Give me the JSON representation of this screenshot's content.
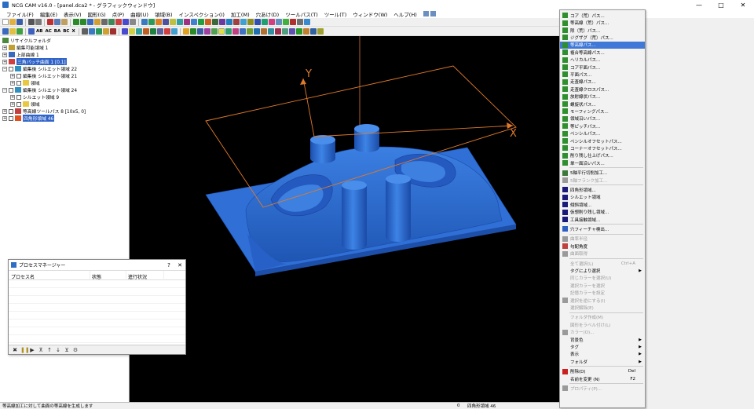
{
  "window": {
    "title": "NCG CAM v16.0 - [panel.dca2 * - グラフィックウィンドウ]"
  },
  "menubar": [
    "ファイル(F)",
    "編集(E)",
    "表示(V)",
    "図形(G)",
    "点(P)",
    "曲線(U)",
    "領域(B)",
    "インスペクション(I)",
    "加工(M)",
    "穴あけ(D)",
    "ツールパス(T)",
    "ツール(T)",
    "ウィンドウ(W)",
    "ヘルプ(H)"
  ],
  "toolbar": {
    "labels": [
      "AB",
      "AC",
      "BA",
      "BC",
      "X"
    ]
  },
  "tree": {
    "items": [
      {
        "label": "リサイクルフォルダ",
        "expander": ""
      },
      {
        "label": "編集可能領域 1",
        "expander": "+"
      },
      {
        "label": "上部曲線 1",
        "expander": "+"
      },
      {
        "label": "三角パッチ曲面 1 [0.1]",
        "expander": "+"
      },
      {
        "label": "編集後 シルエット領域 22",
        "expander": "−"
      },
      {
        "label": "編集後 シルエット領域 21",
        "expander": "+"
      },
      {
        "label": "領域",
        "expander": "+"
      },
      {
        "label": "編集後 シルエット領域 24",
        "expander": "−"
      },
      {
        "label": "シルエット領域 9",
        "expander": "+"
      },
      {
        "label": "領域",
        "expander": "+"
      },
      {
        "label": "等高線ツールパス 8 [10x5, 0]",
        "expander": "+"
      },
      {
        "label": "四角形領域 46",
        "expander": "+"
      }
    ]
  },
  "viewport": {
    "axis_x": "X",
    "axis_y": "Y",
    "model_color": "#2f6fd6"
  },
  "context_menu": {
    "items": [
      {
        "label": "コア（荒）パス...",
        "icon_color": "#2f8f2f",
        "state": "normal"
      },
      {
        "label": "等高線（荒）パス...",
        "icon_color": "#2f8f2f",
        "state": "normal"
      },
      {
        "label": "隙（荒）パス...",
        "icon_color": "#2f8f2f",
        "state": "normal"
      },
      {
        "label": "ジグザグ（荒）パス...",
        "icon_color": "#2f8f2f",
        "state": "normal"
      },
      {
        "label": "等高線パス...",
        "icon_color": "#2f8f2f",
        "state": "highlight"
      },
      {
        "label": "複合等高線パス...",
        "icon_color": "#2f8f2f",
        "state": "normal"
      },
      {
        "label": "ヘリカルパス...",
        "icon_color": "#2f8f2f",
        "state": "normal"
      },
      {
        "label": "コア平面パス...",
        "icon_color": "#2f8f2f",
        "state": "normal"
      },
      {
        "label": "平面パス...",
        "icon_color": "#2f8f2f",
        "state": "normal"
      },
      {
        "label": "走査線パス...",
        "icon_color": "#2f8f2f",
        "state": "normal"
      },
      {
        "label": "走査線クロスパス...",
        "icon_color": "#2f8f2f",
        "state": "normal"
      },
      {
        "label": "放射線状パス...",
        "icon_color": "#2f8f2f",
        "state": "normal"
      },
      {
        "label": "螺旋状パス...",
        "icon_color": "#2f8f2f",
        "state": "normal"
      },
      {
        "label": "モーフィングパス...",
        "icon_color": "#2f8f2f",
        "state": "normal"
      },
      {
        "label": "領域沿いパス...",
        "icon_color": "#2f8f2f",
        "state": "normal"
      },
      {
        "label": "等ピッチパス...",
        "icon_color": "#2f8f2f",
        "state": "normal"
      },
      {
        "label": "ペンシルパス...",
        "icon_color": "#2f8f2f",
        "state": "normal"
      },
      {
        "label": "ペンシルオフセットパス...",
        "icon_color": "#2f8f2f",
        "state": "normal"
      },
      {
        "label": "コーナーオフセットパス...",
        "icon_color": "#2f8f2f",
        "state": "normal"
      },
      {
        "label": "削り残し仕上げパス...",
        "icon_color": "#2f8f2f",
        "state": "normal"
      },
      {
        "label": "単一面沿いパス...",
        "icon_color": "#2f8f2f",
        "state": "normal"
      },
      {
        "sep": true
      },
      {
        "label": "5軸平行切削加工...",
        "icon_color": "#3a7a3a",
        "state": "normal"
      },
      {
        "label": "5軸フランク加工...",
        "icon_color": "#9a9a9a",
        "state": "disabled"
      },
      {
        "sep": true
      },
      {
        "label": "四角形領域...",
        "icon_color": "#1a1a7a",
        "state": "normal"
      },
      {
        "label": "シルエット領域",
        "icon_color": "#1a1a7a",
        "state": "normal"
      },
      {
        "label": "傾斜領域...",
        "icon_color": "#1a1a7a",
        "state": "normal"
      },
      {
        "label": "仮想削り残し領域...",
        "icon_color": "#1a1a7a",
        "state": "normal"
      },
      {
        "label": "工具接触領域...",
        "icon_color": "#1a1a7a",
        "state": "normal"
      },
      {
        "sep": true
      },
      {
        "label": "穴フィーチャ検出...",
        "icon_color": "#2f5fc0",
        "state": "normal"
      },
      {
        "sep": true
      },
      {
        "label": "曲率半径",
        "icon_color": "#9a9a9a",
        "state": "disabled"
      },
      {
        "label": "勾配角度",
        "icon_color": "#c04040",
        "state": "normal"
      },
      {
        "label": "曲面取得",
        "icon_color": "#9a9a9a",
        "state": "disabled"
      },
      {
        "sep": true
      },
      {
        "label": "全て選択(L)",
        "icon_color": "",
        "state": "disabled",
        "shortcut": "Ctrl+A"
      },
      {
        "label": "タグにより選択",
        "icon_color": "",
        "state": "normal",
        "submenu": true
      },
      {
        "label": "同じカラーを選択(U)",
        "icon_color": "",
        "state": "disabled"
      },
      {
        "label": "選択カラーを選択",
        "icon_color": "",
        "state": "disabled"
      },
      {
        "label": "記憶カラーを設定",
        "icon_color": "",
        "state": "disabled"
      },
      {
        "label": "選択を逆にする(I)",
        "icon_color": "#9a9a9a",
        "state": "disabled"
      },
      {
        "label": "選択解除(E)",
        "icon_color": "",
        "state": "disabled"
      },
      {
        "sep": true
      },
      {
        "label": "フォルダ作成(M)",
        "icon_color": "",
        "state": "disabled"
      },
      {
        "label": "図形をラベル付け(L)",
        "icon_color": "",
        "state": "disabled"
      },
      {
        "label": "カラー(O)...",
        "icon_color": "#9a9a9a",
        "state": "disabled"
      },
      {
        "label": "背景色",
        "icon_color": "",
        "state": "normal",
        "submenu": true
      },
      {
        "label": "タグ",
        "icon_color": "",
        "state": "normal",
        "submenu": true
      },
      {
        "label": "表示",
        "icon_color": "",
        "state": "normal",
        "submenu": true
      },
      {
        "label": "フォルダ",
        "icon_color": "",
        "state": "normal",
        "submenu": true
      },
      {
        "sep": true
      },
      {
        "label": "削除(D)",
        "icon_color": "#cc2020",
        "state": "normal",
        "shortcut": "Del"
      },
      {
        "label": "名前を変更 (N)",
        "icon_color": "",
        "state": "normal",
        "shortcut": "F2"
      },
      {
        "sep": true
      },
      {
        "label": "プロパティ(P)...",
        "icon_color": "#9a9a9a",
        "state": "disabled"
      }
    ]
  },
  "process_manager": {
    "title": "プロセスマネージャー",
    "help_button": "?",
    "close_button": "✕",
    "columns": [
      "プロセス名",
      "状態",
      "進行状況"
    ]
  },
  "statusbar": {
    "message": "等高線加工に対して曲面の等高線を生成します",
    "count": "0",
    "selection": "四角形領域 46"
  }
}
